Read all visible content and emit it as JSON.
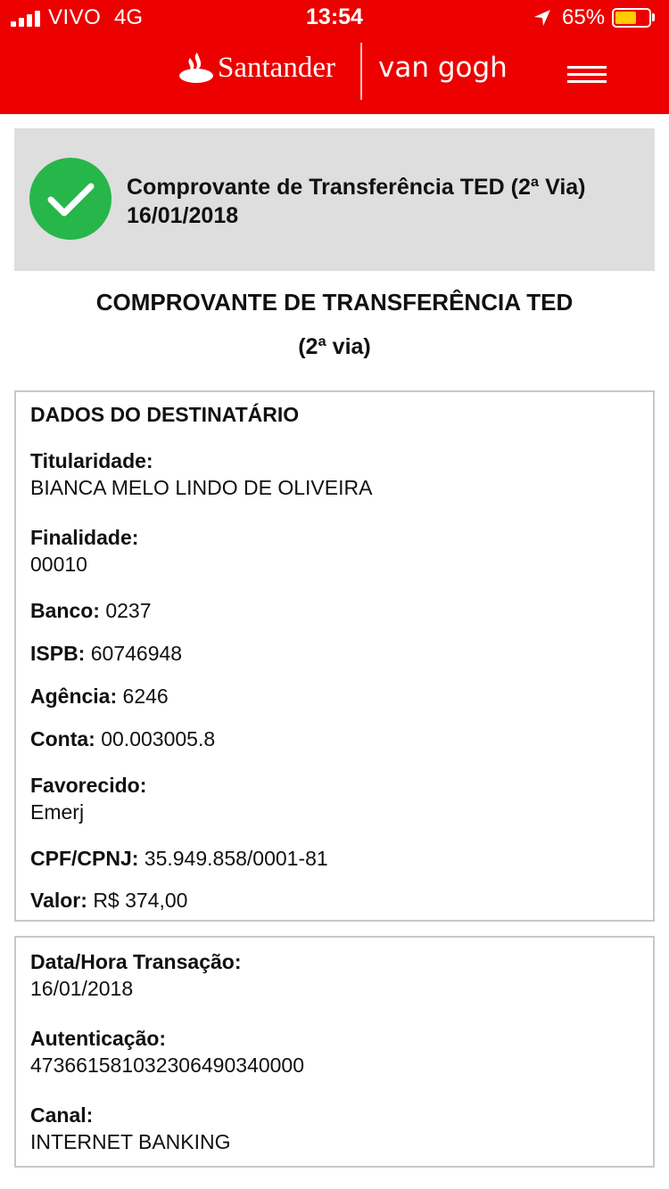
{
  "status_bar": {
    "carrier": "VIVO",
    "network": "4G",
    "time": "13:54",
    "battery_percent": "65%",
    "battery_level": 0.65,
    "battery_color": "#ffcc00"
  },
  "header": {
    "brand": "Santander",
    "segment": "van gogh",
    "background_color": "#ec0000",
    "menu_icon": "hamburger-menu-icon",
    "logo_icon": "santander-flame-icon"
  },
  "banner": {
    "icon": "success-check-icon",
    "icon_color": "#27b64a",
    "title_line1": "Comprovante de Transferência TED (2ª Via)",
    "title_line2": "16/01/2018"
  },
  "page": {
    "title": "COMPROVANTE DE TRANSFERÊNCIA TED",
    "subtitle": "(2ª via)"
  },
  "recipient": {
    "section_title": "DADOS DO DESTINATÁRIO",
    "titularidade_label": "Titularidade:",
    "titularidade_value": "BIANCA MELO LINDO DE OLIVEIRA",
    "finalidade_label": "Finalidade:",
    "finalidade_value": "00010",
    "banco_label": "Banco:",
    "banco_value": "0237",
    "ispb_label": "ISPB:",
    "ispb_value": "60746948",
    "agencia_label": "Agência:",
    "agencia_value": "6246",
    "conta_label": "Conta:",
    "conta_value": "00.003005.8",
    "favorecido_label": "Favorecido:",
    "favorecido_value": "Emerj",
    "cpf_label": "CPF/CPNJ:",
    "cpf_value": "35.949.858/0001-81",
    "valor_label": "Valor:",
    "valor_value": "R$ 374,00"
  },
  "transaction": {
    "datahora_label": "Data/Hora Transação:",
    "datahora_value": "16/01/2018",
    "autenticacao_label": "Autenticação:",
    "autenticacao_value": "473661581032306490340000",
    "canal_label": "Canal:",
    "canal_value": "INTERNET BANKING"
  }
}
